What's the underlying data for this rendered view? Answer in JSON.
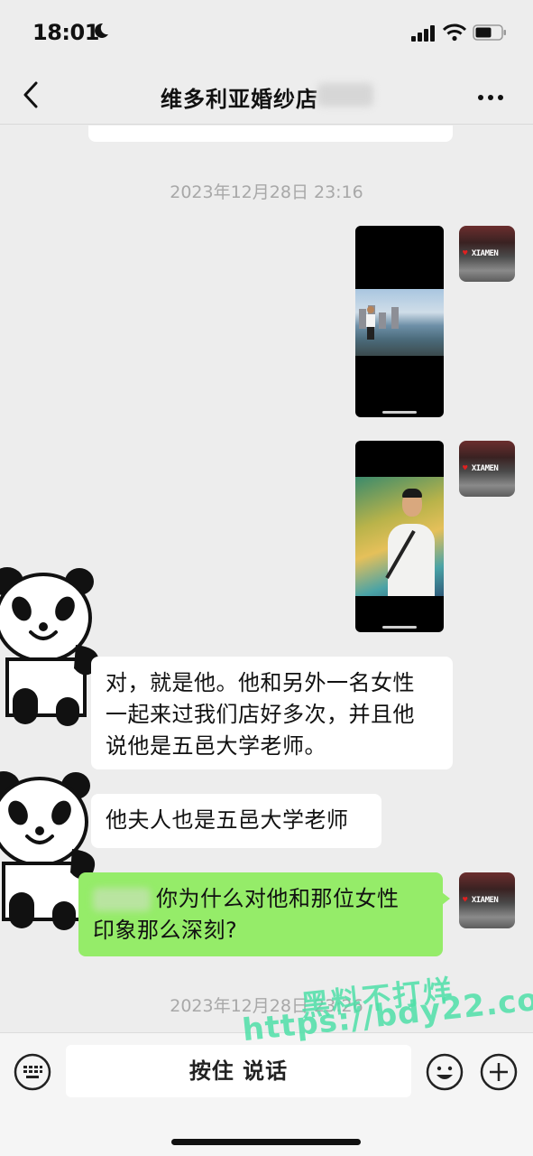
{
  "status_bar": {
    "time": "18:01"
  },
  "header": {
    "title": "维多利亚婚纱店"
  },
  "timestamps": [
    "2023年12月28日 23:16",
    "2023年12月28日 23:26"
  ],
  "messages": [
    {
      "from": "me",
      "type": "image",
      "content": "photo-man-by-waterfront"
    },
    {
      "from": "me",
      "type": "image",
      "content": "photo-man-with-lights"
    },
    {
      "from": "other",
      "type": "text",
      "lines": [
        "对，就是他。他和另外一名女性",
        "一起来过我们店好多次，并且他",
        "说他是五邑大学老师。"
      ]
    },
    {
      "from": "other",
      "type": "text",
      "lines": [
        "他夫人也是五邑大学老师"
      ]
    },
    {
      "from": "me",
      "type": "text",
      "lines": [
        "你为什么对他和那位女性",
        "印象那么深刻?"
      ]
    }
  ],
  "avatar_sign": {
    "text": "XIAMEN"
  },
  "input_bar": {
    "hold_to_talk": "按住 说话"
  },
  "watermark": {
    "line1": "黑料不打烊",
    "line2": "https://bdy22.co"
  },
  "icons": [
    "back-chevron-icon",
    "more-dots-icon",
    "keyboard-icon",
    "emoji-icon",
    "plus-icon",
    "signal-icon",
    "wifi-icon",
    "battery-icon",
    "moon-icon"
  ],
  "colors": {
    "background": "#ededed",
    "outgoing_bubble": "#95ec69",
    "incoming_bubble": "#ffffff",
    "watermark": "#4fe0a8"
  }
}
